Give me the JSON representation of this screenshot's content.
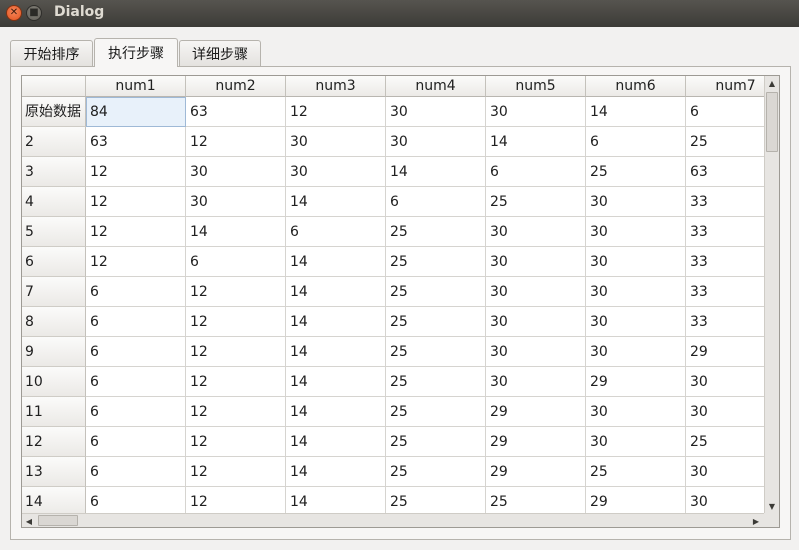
{
  "window": {
    "title": "Dialog",
    "close_glyph": "✕",
    "minimize_glyph": "■"
  },
  "tabs": [
    {
      "label": "开始排序",
      "active": false
    },
    {
      "label": "执行步骤",
      "active": true
    },
    {
      "label": "详细步骤",
      "active": false
    }
  ],
  "table": {
    "columns": [
      "num1",
      "num2",
      "num3",
      "num4",
      "num5",
      "num6",
      "num7"
    ],
    "rows": [
      {
        "label": "原始数据",
        "values": [
          "84",
          "63",
          "12",
          "30",
          "30",
          "14",
          "6"
        ]
      },
      {
        "label": "2",
        "values": [
          "63",
          "12",
          "30",
          "30",
          "14",
          "6",
          "25"
        ]
      },
      {
        "label": "3",
        "values": [
          "12",
          "30",
          "30",
          "14",
          "6",
          "25",
          "63"
        ]
      },
      {
        "label": "4",
        "values": [
          "12",
          "30",
          "14",
          "6",
          "25",
          "30",
          "33"
        ]
      },
      {
        "label": "5",
        "values": [
          "12",
          "14",
          "6",
          "25",
          "30",
          "30",
          "33"
        ]
      },
      {
        "label": "6",
        "values": [
          "12",
          "6",
          "14",
          "25",
          "30",
          "30",
          "33"
        ]
      },
      {
        "label": "7",
        "values": [
          "6",
          "12",
          "14",
          "25",
          "30",
          "30",
          "33"
        ]
      },
      {
        "label": "8",
        "values": [
          "6",
          "12",
          "14",
          "25",
          "30",
          "30",
          "33"
        ]
      },
      {
        "label": "9",
        "values": [
          "6",
          "12",
          "14",
          "25",
          "30",
          "30",
          "29"
        ]
      },
      {
        "label": "10",
        "values": [
          "6",
          "12",
          "14",
          "25",
          "30",
          "29",
          "30"
        ]
      },
      {
        "label": "11",
        "values": [
          "6",
          "12",
          "14",
          "25",
          "29",
          "30",
          "30"
        ]
      },
      {
        "label": "12",
        "values": [
          "6",
          "12",
          "14",
          "25",
          "29",
          "30",
          "25"
        ]
      },
      {
        "label": "13",
        "values": [
          "6",
          "12",
          "14",
          "25",
          "29",
          "25",
          "30"
        ]
      },
      {
        "label": "14",
        "values": [
          "6",
          "12",
          "14",
          "25",
          "25",
          "29",
          "30"
        ]
      }
    ],
    "current_cell": {
      "row": 0,
      "col": 0
    }
  },
  "scrollbars": {
    "up_arrow": "▲",
    "down_arrow": "▼",
    "left_arrow": "◀",
    "right_arrow": "▶"
  }
}
